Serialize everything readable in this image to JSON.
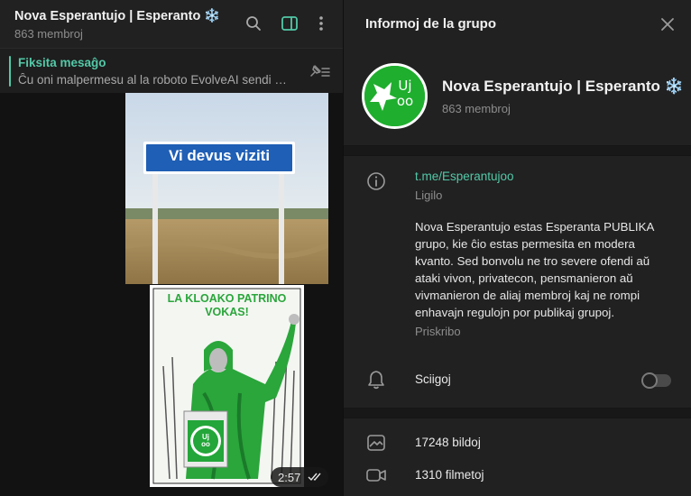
{
  "chat": {
    "title": "Nova Esperantujo | Esperanto ❄️",
    "subtitle": "863 membroj",
    "pinned_label": "Fiksita mesaĝo",
    "pinned_text": "Ĉu oni malpermesu al la roboto EvolveAI sendi bi...",
    "photo_sign_text": "Vi devus viziti",
    "poster_text": "LA KLOAKO PATRINO VOKAS!",
    "poster_logo": "Uj oo",
    "message_time": "2:57"
  },
  "info": {
    "title": "Informoj de la grupo",
    "group_name": "Nova Esperantujo | Esperanto ❄️",
    "members": "863 membroj",
    "avatar_text": "Uj oo",
    "link": "t.me/Esperantujoo",
    "link_label": "Ligilo",
    "description": "Nova Esperantujo estas Esperanta PUBLIKA grupo, kie ĉio estas permesita en modera kvanto. Sed bonvolu ne tro severe ofendi aŭ ataki vivon, privatecon, pensmanieron aŭ vivmanieron de aliaj membroj kaj ne rompi enhavajn regulojn por publikaj grupoj.",
    "description_label": "Priskribo",
    "notifications_label": "Sciigoj",
    "notifications_on": false,
    "photos_label": "17248 bildoj",
    "videos_label": "1310 filmetoj"
  },
  "colors": {
    "accent": "#53c9a7",
    "brand_green": "#1fae2e",
    "sign_blue": "#1f5fb5"
  },
  "icons": [
    "search-icon",
    "sidebar-toggle-icon",
    "more-icon",
    "pin-list-icon",
    "close-icon",
    "info-icon",
    "bell-icon",
    "photos-icon",
    "video-icon",
    "read-checks-icon"
  ]
}
